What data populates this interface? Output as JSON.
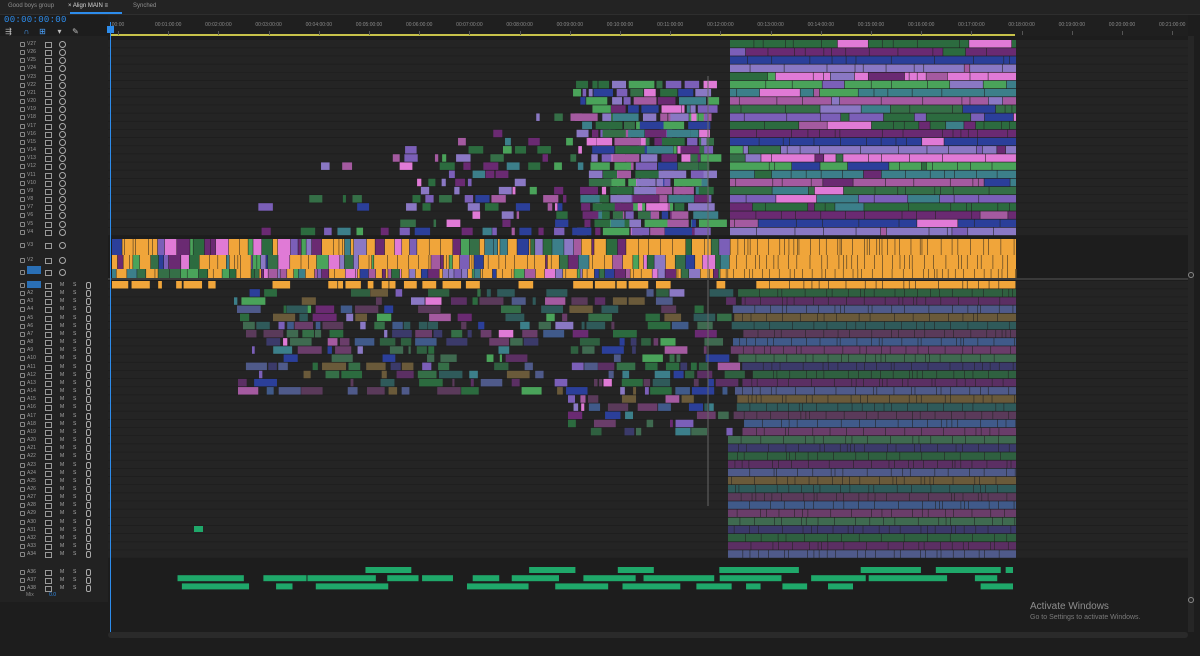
{
  "tabs": [
    {
      "label": "Good boys group",
      "active": false
    },
    {
      "label": "×  Align MAIN  ≡",
      "active": true
    },
    {
      "label": "Synched",
      "active": false
    }
  ],
  "timecode": "00:00:00:00",
  "ruler": {
    "labels": [
      "00:00",
      "00:01:00:00",
      "00:02:00:00",
      "00:03:00:00",
      "00:04:00:00",
      "00:05:00:00",
      "00:06:00:00",
      "00:07:00:00",
      "00:08:00:00",
      "00:09:00:00",
      "00:10:00:00",
      "00:11:00:00",
      "00:12:00:00",
      "00:13:00:00",
      "00:14:00:00",
      "00:15:00:00",
      "00:16:00:00",
      "00:17:00:00",
      "00:18:00:00",
      "00:19:00:00",
      "00:20:00:00",
      "00:21:00:00"
    ]
  },
  "video_tracks": [
    "V27",
    "V26",
    "V25",
    "V24",
    "V23",
    "V22",
    "V21",
    "V20",
    "V19",
    "V18",
    "V17",
    "V16",
    "V15",
    "V14",
    "V13",
    "V12",
    "V11",
    "V10",
    "V9",
    "V8",
    "V7",
    "V6",
    "V5",
    "V4",
    "V3",
    "V2",
    "V1"
  ],
  "audio_tracks": [
    "A1",
    "A2",
    "A3",
    "A4",
    "A5",
    "A6",
    "A7",
    "A8",
    "A9",
    "A10",
    "A11",
    "A12",
    "A13",
    "A14",
    "A15",
    "A16",
    "A17",
    "A18",
    "A19",
    "A20",
    "A21",
    "A22",
    "A23",
    "A24",
    "A25",
    "A26",
    "A27",
    "A28",
    "A29",
    "A30",
    "A31",
    "A32",
    "A33",
    "A34"
  ],
  "extra_tracks": [
    "A36",
    "A37",
    "A38"
  ],
  "track_controls": {
    "mute": "M",
    "solo": "S"
  },
  "mix_label": "Mix",
  "mix_value": "0.0",
  "colors": {
    "accent": "#2d8ceb",
    "orange": "#f0a53a",
    "green": "#2c6b3f",
    "purple": "#6a2a72",
    "blue": "#2b3f9a",
    "lavender": "#8a78c4",
    "pink": "#e07ad6",
    "audio_green": "#1fa86a"
  },
  "watermark": {
    "title": "Activate Windows",
    "subtitle": "Go to Settings to activate Windows."
  },
  "icons": [
    "snap-icon",
    "magnet-icon",
    "linked-selection-icon",
    "marker-icon",
    "wrench-icon"
  ]
}
